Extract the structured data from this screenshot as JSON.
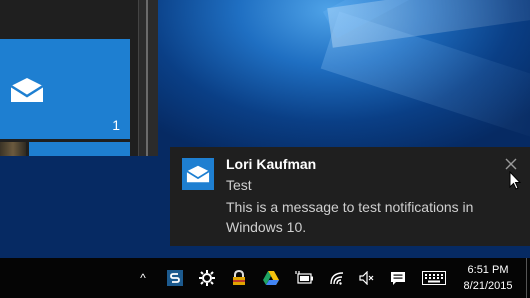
{
  "start_menu": {
    "mail_tile": {
      "icon": "mail-icon",
      "badge_count": "1"
    }
  },
  "notification": {
    "app_icon": "mail-icon",
    "sender": "Lori Kaufman",
    "subject": "Test",
    "body": "This is a message to test notifications in Windows 10.",
    "close_icon": "close-icon"
  },
  "taskbar": {
    "tray": {
      "overflow_icon": "chevron-up-icon",
      "chevron_glyph": "^",
      "icons": [
        "snagit-icon",
        "settings-cog-icon",
        "lock-user-icon",
        "google-drive-icon",
        "battery-plug-icon",
        "wifi-icon",
        "volume-muted-icon",
        "action-center-icon",
        "keyboard-icon"
      ]
    },
    "clock": {
      "time": "6:51 PM",
      "date": "8/21/2015"
    }
  },
  "colors": {
    "accent": "#1e7fd1",
    "toast_bg": "#1f1f1f",
    "taskbar_bg": "#050505"
  }
}
